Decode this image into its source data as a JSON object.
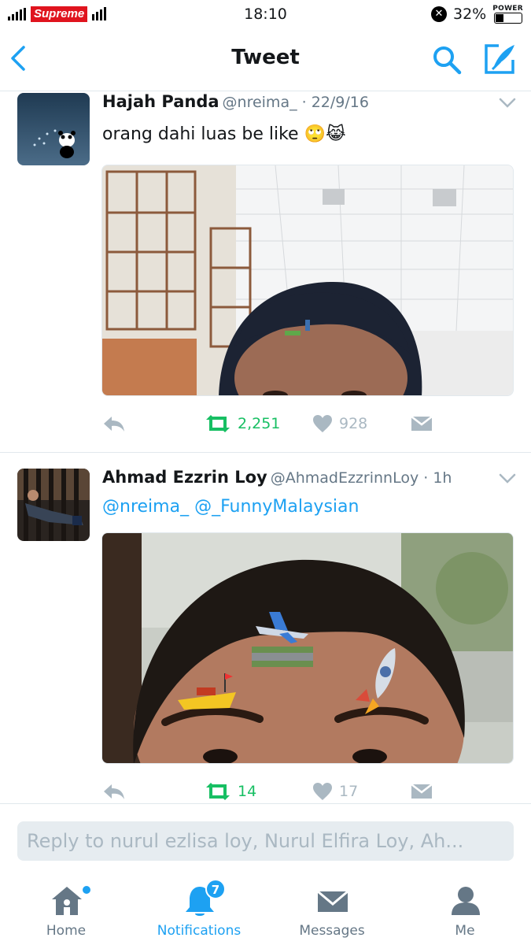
{
  "status_bar": {
    "carrier": "Supreme",
    "time": "18:10",
    "battery_percent": "32%",
    "battery_label": "POWER",
    "battery_level": 0.32
  },
  "header": {
    "title": "Tweet",
    "back_icon": "chevron-left-icon",
    "search_icon": "search-icon",
    "compose_icon": "compose-icon"
  },
  "tweets": [
    {
      "name": "Hajah Panda",
      "meta": "@nreima_ · 22/9/16",
      "text": "orang dahi luas be like 🙄😹",
      "reply_icon": "reply-icon",
      "retweets": "2,251",
      "likes": "928",
      "dm_icon": "direct-message-icon"
    },
    {
      "name": "Ahmad Ezzrin Loy",
      "meta": "@AhmadEzzrinnLoy · 1h",
      "mentions": [
        "@nreima_",
        "@_FunnyMalaysian"
      ],
      "reply_icon": "reply-icon",
      "retweets": "14",
      "likes": "17",
      "dm_icon": "direct-message-icon"
    }
  ],
  "reply": {
    "placeholder": "Reply to nurul ezlisa loy, Nurul Elfira Loy, Ah..."
  },
  "tabs": [
    {
      "label": "Home",
      "icon": "home-icon",
      "active": false
    },
    {
      "label": "Notifications",
      "icon": "bell-icon",
      "active": true,
      "badge": "7"
    },
    {
      "label": "Messages",
      "icon": "envelope-icon",
      "active": false
    },
    {
      "label": "Me",
      "icon": "person-icon",
      "active": false
    }
  ],
  "colors": {
    "accent": "#1da1f2",
    "retweet": "#17bf63",
    "muted": "#aab8c2",
    "carrier_red": "#e0141e"
  }
}
